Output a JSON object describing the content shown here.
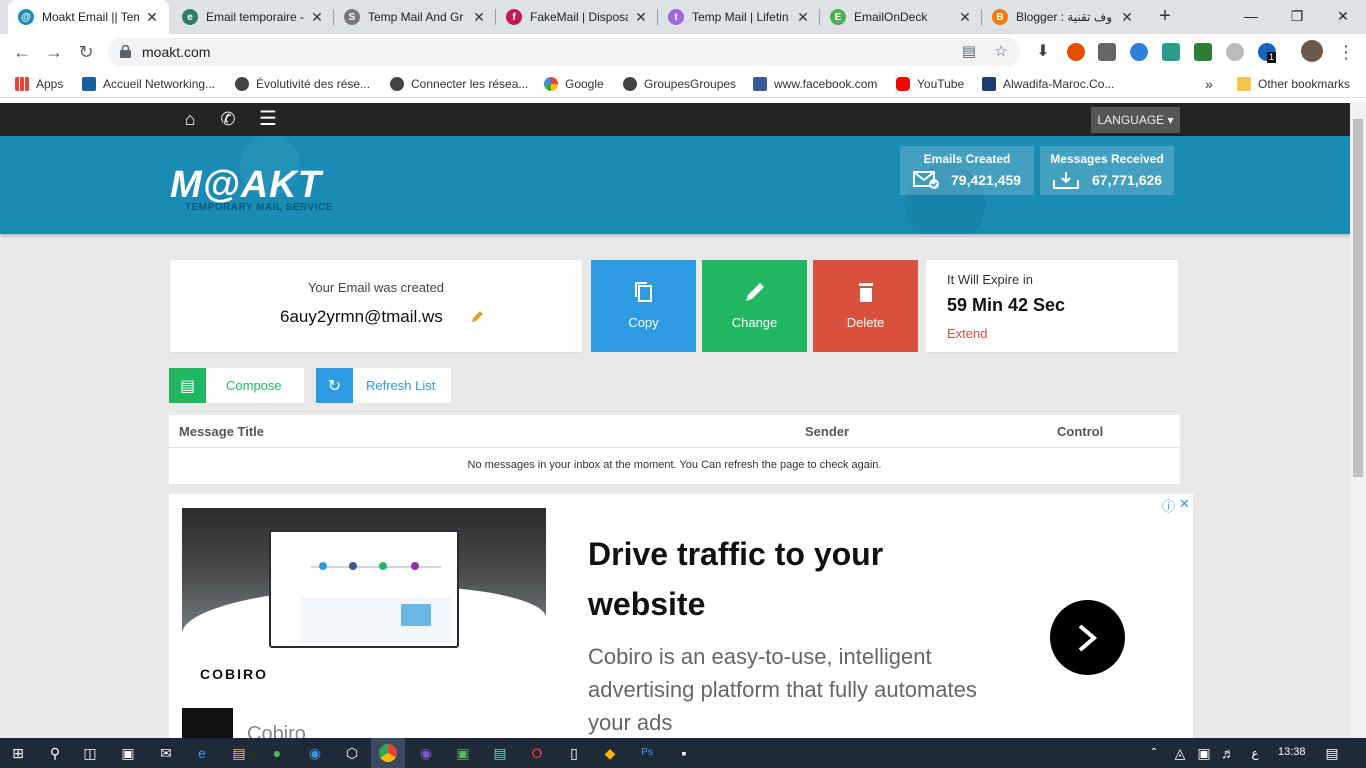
{
  "browser": {
    "tabs": [
      {
        "title": "Moakt Email || Tem",
        "color": "#1a8bb4",
        "glyph": "@",
        "active": true
      },
      {
        "title": "Email temporaire -",
        "color": "#2e7d6b",
        "glyph": "e"
      },
      {
        "title": "Temp Mail And Gr",
        "color": "#777777",
        "glyph": "S"
      },
      {
        "title": "FakeMail | Disposa",
        "color": "#c2185b",
        "glyph": "f"
      },
      {
        "title": "Temp Mail | Lifetin",
        "color": "#9c6ade",
        "glyph": "t"
      },
      {
        "title": "EmailOnDeck",
        "color": "#4caf50",
        "glyph": "E"
      },
      {
        "title": "Blogger : وف تقنية",
        "color": "#f57c00",
        "glyph": "B"
      }
    ],
    "tab_close_glyph": "✕",
    "new_tab_glyph": "+",
    "window_controls": {
      "minimize": "—",
      "restore": "❐",
      "close": "✕"
    },
    "url": "moakt.com",
    "bookmarks": [
      {
        "label": "Apps",
        "color": "#4285f4"
      },
      {
        "label": "Accueil Networking...",
        "color": "#1b5e9b"
      },
      {
        "label": "Évolutivité des rése...",
        "color": "#444444"
      },
      {
        "label": "Connecter les résea...",
        "color": "#444444"
      },
      {
        "label": "Google",
        "color": "#ea4335"
      },
      {
        "label": "GroupesGroupes",
        "color": "#444444"
      },
      {
        "label": "www.facebook.com",
        "color": "#3b5998"
      },
      {
        "label": "YouTube",
        "color": "#ff0000"
      },
      {
        "label": "Alwadifa-Maroc.Co...",
        "color": "#1a3d6e"
      }
    ],
    "bookmarks_overflow": "»",
    "other_bookmarks": "Other bookmarks",
    "ext_badge": "1"
  },
  "site": {
    "nav_icons": [
      "home-icon",
      "phone-icon",
      "menu-icon"
    ],
    "language_label": "LANGUAGE ▾",
    "logo_text": "M@AKT",
    "logo_subtitle": "TEMPORARY MAIL SERVICE",
    "stats": {
      "emails_created_label": "Emails Created",
      "emails_created_value": "79,421,459",
      "messages_received_label": "Messages Received",
      "messages_received_value": "67,771,626"
    },
    "email_card": {
      "label": "Your Email was created",
      "address": "6auy2yrmn@tmail.ws"
    },
    "actions": {
      "copy": "Copy",
      "change": "Change",
      "delete": "Delete",
      "copy_color": "#2d9be1",
      "change_color": "#21b761",
      "delete_color": "#d9503c"
    },
    "expire": {
      "label": "It Will Expire in",
      "time": "59 Min 42 Sec",
      "extend": "Extend"
    },
    "compose": "Compose",
    "refresh": "Refresh List",
    "table": {
      "col_title": "Message Title",
      "col_sender": "Sender",
      "col_control": "Control",
      "empty": "No messages in your inbox at the moment. You Can refresh the page to check again."
    },
    "ad": {
      "headline": "Drive traffic to your website",
      "body": "Cobiro is an easy-to-use, intelligent advertising platform that fully automates your ads",
      "brand": "COBIRO",
      "brand_name": "Cobiro",
      "info_glyph": "ⓘ",
      "close_glyph": "✕"
    }
  },
  "taskbar": {
    "time": "13:38",
    "lang": "ع"
  }
}
